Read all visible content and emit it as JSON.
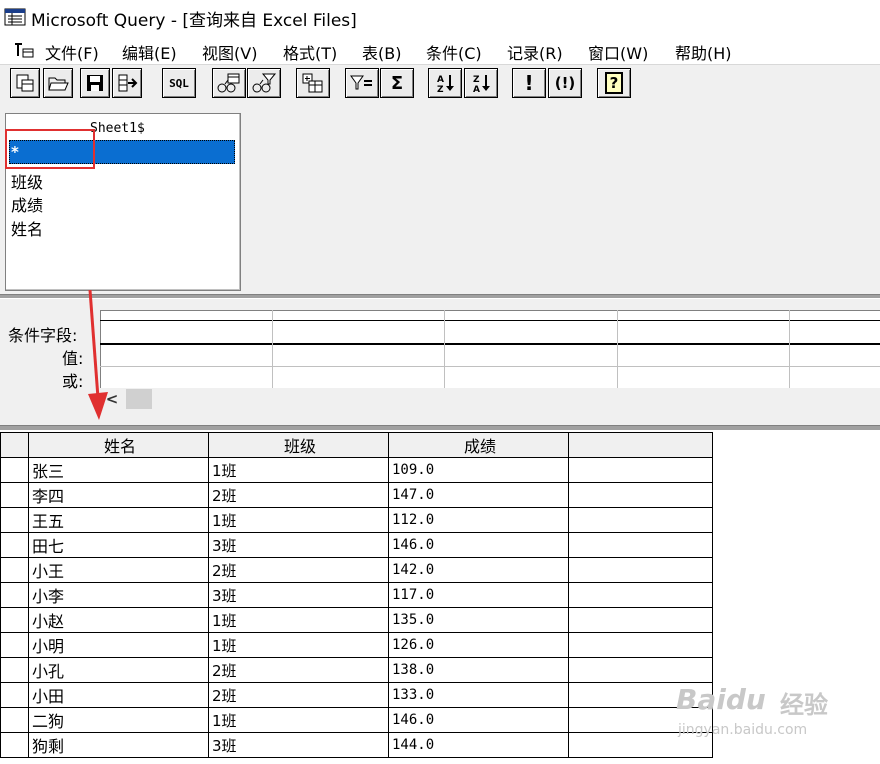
{
  "window": {
    "title": "Microsoft Query - [查询来自 Excel Files]"
  },
  "menu": [
    "文件(F)",
    "编辑(E)",
    "视图(V)",
    "格式(T)",
    "表(B)",
    "条件(C)",
    "记录(R)",
    "窗口(W)",
    "帮助(H)"
  ],
  "toolbar": {
    "sql_label": "SQL",
    "sigma_label": "Σ",
    "exclaim_label": "!",
    "auto_label": "(!)",
    "help_label": "?"
  },
  "table_window": {
    "name": "Sheet1$",
    "fields": [
      "*",
      "班级",
      "成绩",
      "姓名"
    ],
    "selected_field": "*"
  },
  "criteria": {
    "labels": {
      "field": "条件字段:",
      "value": "值:",
      "or": "或:"
    },
    "scroll_left": "<"
  },
  "grid": {
    "columns": [
      "姓名",
      "班级",
      "成绩"
    ],
    "rows": [
      [
        "张三",
        "1班",
        "109.0"
      ],
      [
        "李四",
        "2班",
        "147.0"
      ],
      [
        "王五",
        "1班",
        "112.0"
      ],
      [
        "田七",
        "3班",
        "146.0"
      ],
      [
        "小王",
        "2班",
        "142.0"
      ],
      [
        "小李",
        "3班",
        "117.0"
      ],
      [
        "小赵",
        "1班",
        "135.0"
      ],
      [
        "小明",
        "1班",
        "126.0"
      ],
      [
        "小孔",
        "2班",
        "138.0"
      ],
      [
        "小田",
        "2班",
        "133.0"
      ],
      [
        "二狗",
        "1班",
        "146.0"
      ],
      [
        "狗剩",
        "3班",
        "144.0"
      ]
    ]
  },
  "watermark": {
    "brand": "Baidu",
    "cn": "经验",
    "url": "jingyan.baidu.com"
  },
  "colors": {
    "selection": "#0a6ed1",
    "annotation_red": "#e03030"
  }
}
